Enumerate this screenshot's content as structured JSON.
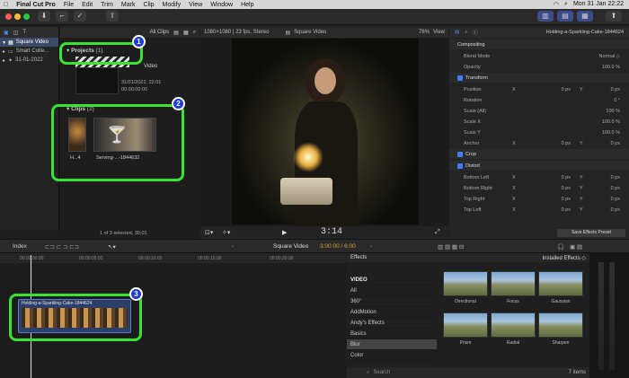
{
  "menubar": {
    "apple": "",
    "app": "Final Cut Pro",
    "items": [
      "File",
      "Edit",
      "Trim",
      "Mark",
      "Clip",
      "Modify",
      "View",
      "Window",
      "Help"
    ],
    "clock": "Mon 31 Jan 22:22"
  },
  "library": {
    "items": [
      "Square Video",
      "Smart Colle...",
      "31-01-2022"
    ]
  },
  "browser": {
    "filter": "All Clips",
    "projects_label": "Projects",
    "projects_count": "(1)",
    "project_name": "Video",
    "project_date": "31/01/2022, 22:01",
    "project_tc": "00:00:00:00",
    "clips_label": "Clips",
    "clips_count": "(2)",
    "clip1": "H...4",
    "clip2": "Serving-...-1844632",
    "status": "1 of 3 selected, 30;01"
  },
  "viewer": {
    "format": "1080×1080 | 23 fps, Stereo",
    "title": "Square Video",
    "zoom": "78%",
    "view": "View",
    "timecode": "3:14"
  },
  "inspector": {
    "clipname": "Holding-a-Sparkling-Cake-1844624",
    "rows": [
      {
        "k": "Compositing",
        "type": "head"
      },
      {
        "k": "Blend Mode",
        "v": "Normal ◇"
      },
      {
        "k": "Opacity",
        "v": "100.0 %"
      },
      {
        "k": "Transform",
        "type": "headcb"
      },
      {
        "k": "Position",
        "x": "0 px",
        "y": "0 px",
        "xl": "X",
        "yl": "Y"
      },
      {
        "k": "Rotation",
        "v": "0 °"
      },
      {
        "k": "Scale (All)",
        "v": "100 %"
      },
      {
        "k": "Scale X",
        "v": "100.0 %"
      },
      {
        "k": "Scale Y",
        "v": "100.0 %"
      },
      {
        "k": "Anchor",
        "x": "0 px",
        "y": "0 px",
        "xl": "X",
        "yl": "Y"
      },
      {
        "k": "Crop",
        "type": "headcb"
      },
      {
        "k": "Distort",
        "type": "headcb"
      },
      {
        "k": "Bottom Left",
        "x": "0 px",
        "y": "0 px",
        "xl": "X",
        "yl": "Y"
      },
      {
        "k": "Bottom Right",
        "x": "0 px",
        "y": "0 px",
        "xl": "X",
        "yl": "Y"
      },
      {
        "k": "Top Right",
        "x": "0 px",
        "y": "0 px",
        "xl": "X",
        "yl": "Y"
      },
      {
        "k": "Top Left",
        "x": "0 px",
        "y": "0 px",
        "xl": "X",
        "yl": "Y"
      }
    ],
    "save": "Save Effects Preset"
  },
  "timeline": {
    "index": "Index",
    "project": "Square Video",
    "tc": "3:00:00 / 6:00",
    "clip": "Holding-a-Sparkling-Cake-1844624",
    "ruler": [
      "00:00:00:00",
      "00:00:05:00",
      "00:00:10:00",
      "00:00:15:00",
      "00:00:20:00"
    ]
  },
  "effects": {
    "title": "Effects",
    "installed": "Installed Effects ◇",
    "categories": [
      "VIDEO",
      "All",
      "360°",
      "AddMotion",
      "Andy's Effects",
      "Basics",
      "Blur",
      "Color"
    ],
    "selected": "Blur",
    "items": [
      "Directional",
      "Focus",
      "Gaussian",
      "Prism",
      "Radial",
      "Sharpen"
    ],
    "search": "Search",
    "count": "7 items"
  },
  "callouts": [
    "1",
    "2",
    "3"
  ],
  "colors": {
    "accent": "#39e334",
    "badge": "#1d3bd8",
    "checkbox": "#3d7cff"
  }
}
